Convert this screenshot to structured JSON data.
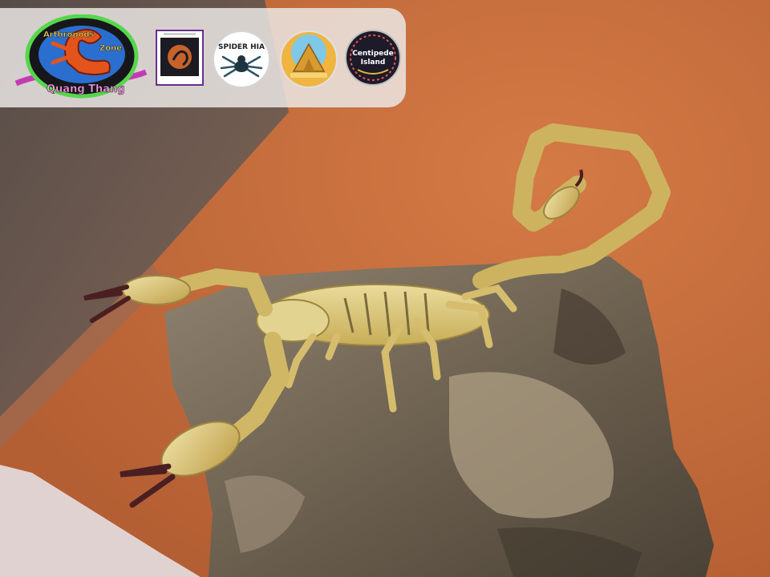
{
  "brand": {
    "main_logo": {
      "line1": "Arthropods",
      "line2": "Zone",
      "line3": "Quang Thang"
    },
    "logos": [
      {
        "name": "square-scorpion-logo",
        "caption": ""
      },
      {
        "name": "spider-hia-logo",
        "text": "SPIDER HIA"
      },
      {
        "name": "pyramid-logo",
        "caption": ""
      },
      {
        "name": "centipede-island-logo",
        "line1": "Centipede",
        "line2": "Island"
      }
    ]
  },
  "photo": {
    "subject": "scorpion",
    "colors": {
      "sand": "#c9703f",
      "rock": "#6f6453",
      "scorpion": "#d8c06a",
      "tip": "#4a1f22"
    }
  }
}
